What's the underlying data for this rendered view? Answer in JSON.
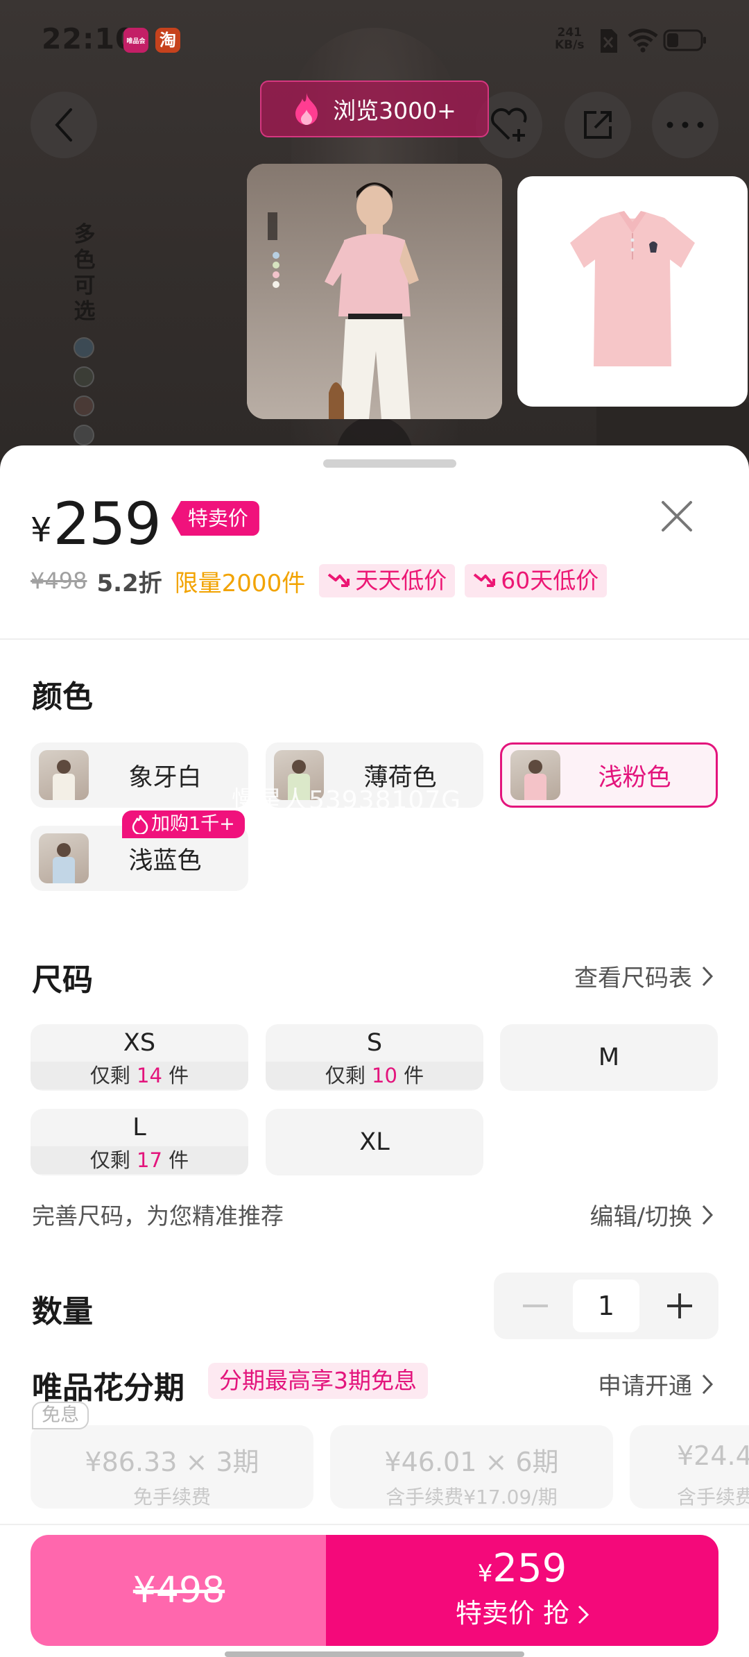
{
  "status_bar": {
    "time": "22:10",
    "app_icon_1": "唯品会",
    "app_icon_2": "淘",
    "net_speed_value": "241",
    "net_speed_unit": "KB/s"
  },
  "top": {
    "views_label": "浏览3000+",
    "background_vertical_text": "多色可选",
    "icons": [
      "back-icon",
      "favorite-add-icon",
      "share-icon",
      "more-icon",
      "flame-icon"
    ]
  },
  "price": {
    "currency": "¥",
    "sale_price": "259",
    "sale_badge": "特卖价",
    "original_price": "¥498",
    "discount": "5.2折",
    "limit": "限量2000件",
    "tag_daily_low": "天天低价",
    "tag_60day_low": "60天低价"
  },
  "color_section": {
    "title": "颜色",
    "options": [
      {
        "name": "象牙白",
        "selected": false
      },
      {
        "name": "薄荷色",
        "selected": false
      },
      {
        "name": "浅粉色",
        "selected": true
      },
      {
        "name": "浅蓝色",
        "selected": false
      }
    ],
    "hot_tag": "加购1千+",
    "watermark": "慢星人53938107G"
  },
  "size_section": {
    "title": "尺码",
    "chart_link": "查看尺码表",
    "options": [
      {
        "size": "XS",
        "stock_prefix": "仅剩",
        "stock_count": "14",
        "stock_suffix": "件"
      },
      {
        "size": "S",
        "stock_prefix": "仅剩",
        "stock_count": "10",
        "stock_suffix": "件"
      },
      {
        "size": "M"
      },
      {
        "size": "L",
        "stock_prefix": "仅剩",
        "stock_count": "17",
        "stock_suffix": "件"
      },
      {
        "size": "XL"
      }
    ],
    "hint": "完善尺码，为您精准推荐",
    "edit_link": "编辑/切换"
  },
  "quantity": {
    "title": "数量",
    "value": "1"
  },
  "installment": {
    "title": "唯品花分期",
    "promo": "分期最高享3期免息",
    "apply_link": "申请开通",
    "free_tag": "免息",
    "plans": [
      {
        "amount": "¥86.33 × 3期",
        "fee": "免手续费"
      },
      {
        "amount": "¥46.01 × 6期",
        "fee": "含手续费¥17.09/期"
      },
      {
        "amount": "¥24.4",
        "fee": "含手续费"
      }
    ]
  },
  "bottom_bar": {
    "original_price": "¥498",
    "buy_currency": "¥",
    "buy_price": "259",
    "buy_label": "特卖价 抢"
  },
  "colors": {
    "accent": "#f0127c",
    "accent_light": "#ff67ad",
    "limit_orange": "#f2a300"
  }
}
